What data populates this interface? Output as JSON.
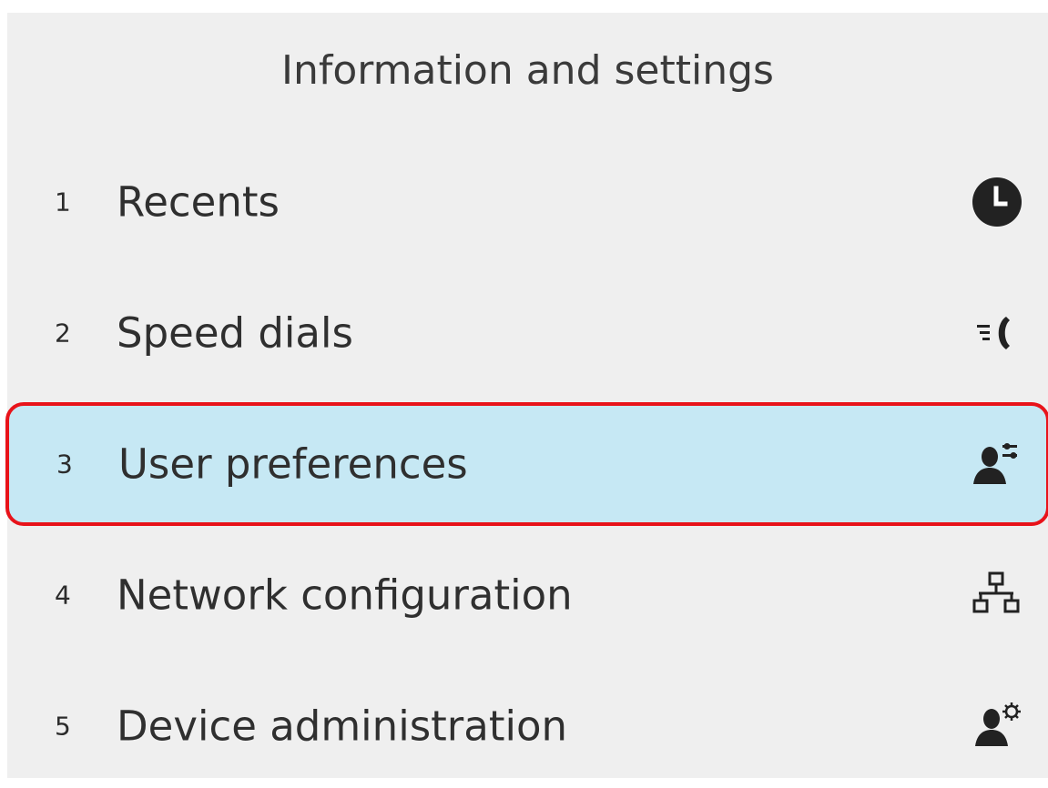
{
  "header": {
    "title": "Information and settings"
  },
  "menu": {
    "items": [
      {
        "number": "1",
        "label": "Recents",
        "icon": "clock-icon"
      },
      {
        "number": "2",
        "label": "Speed dials",
        "icon": "speed-dial-icon"
      },
      {
        "number": "3",
        "label": "User preferences",
        "icon": "user-preferences-icon",
        "selected": true
      },
      {
        "number": "4",
        "label": "Network configuration",
        "icon": "network-icon"
      },
      {
        "number": "5",
        "label": "Device administration",
        "icon": "admin-icon"
      }
    ]
  },
  "colors": {
    "background": "#efefef",
    "selected_fill": "#c6e8f4",
    "selected_outline": "#e8131a",
    "text": "#2f2f2f"
  }
}
